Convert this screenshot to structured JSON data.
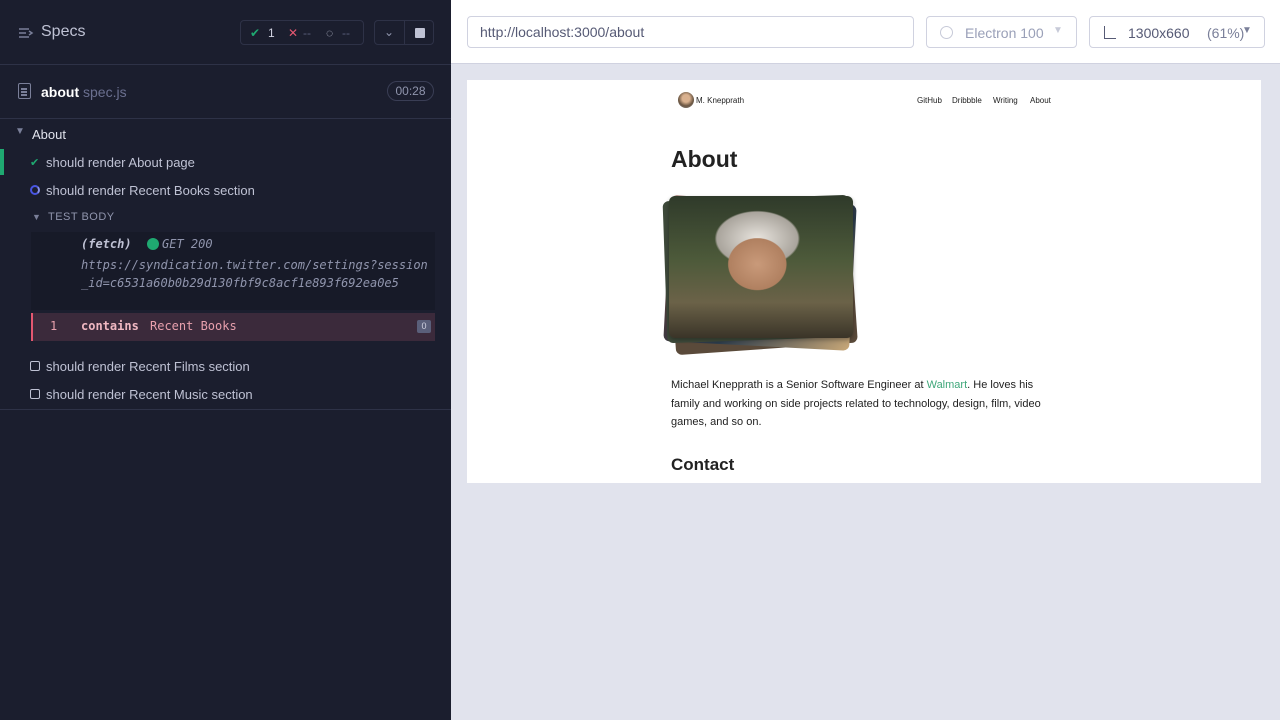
{
  "sidebar": {
    "title": "Specs",
    "stats": {
      "passed": "1",
      "failed": "--",
      "pending": "--"
    }
  },
  "file": {
    "name": "about",
    "ext": "spec.js",
    "duration": "00:28"
  },
  "suite": {
    "title": "About",
    "tests": [
      {
        "label": "should render About page",
        "state": "passed"
      },
      {
        "label": "should render Recent Books section",
        "state": "running"
      },
      {
        "label": "should render Recent Films section",
        "state": "pending"
      },
      {
        "label": "should render Recent Music section",
        "state": "pending"
      }
    ]
  },
  "test_body": {
    "label": "TEST BODY",
    "fetch": {
      "keyword": "(fetch)",
      "status": "GET 200",
      "url": "https://syndication.twitter.com/settings?session_id=c6531a60b0b29d130fbf9c8acf1e893f692ea0e5"
    },
    "command": {
      "number": "1",
      "name": "contains",
      "arg": "Recent Books",
      "badge": "0"
    }
  },
  "toolbar": {
    "url": "http://localhost:3000/about",
    "browser": "Electron 100",
    "viewport_size": "1300x660",
    "viewport_scale": "(61%)"
  },
  "site": {
    "name": "M. Knepprath",
    "nav": [
      "GitHub",
      "Dribbble",
      "Writing",
      "About"
    ],
    "heading": "About",
    "bio_before": "Michael Knepprath is a Senior Software Engineer at ",
    "bio_link": "Walmart",
    "bio_after": ". He loves his family and working on side projects related to technology, design, film, video games, and so on.",
    "contact_heading": "Contact"
  },
  "colors": {
    "pass": "#1fa971",
    "fail": "#e45770",
    "running": "#4956e3",
    "link": "#3fa77a"
  }
}
